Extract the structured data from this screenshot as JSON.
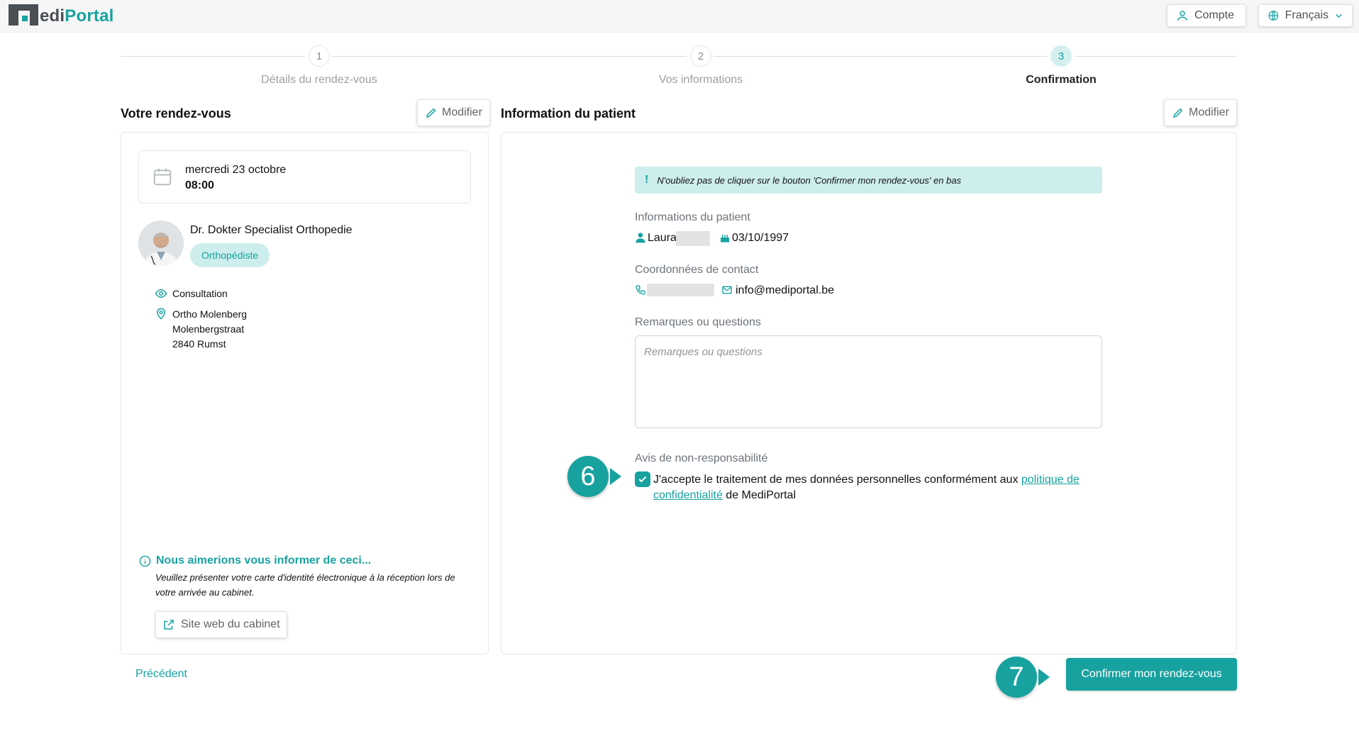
{
  "header": {
    "logo_prefix": "M",
    "logo_dark": "edi",
    "logo_teal": "Portal",
    "account_label": "Compte",
    "language_label": "Français"
  },
  "stepper": {
    "steps": [
      {
        "number": "1",
        "label": "Détails du rendez-vous"
      },
      {
        "number": "2",
        "label": "Vos informations"
      },
      {
        "number": "3",
        "label": "Confirmation"
      }
    ],
    "active_step": 3
  },
  "appointment": {
    "title": "Votre rendez-vous",
    "modify_label": "Modifier",
    "date": "mercredi 23 octobre",
    "time": "08:00",
    "doctor_name": "Dr. Dokter Specialist Orthopedie",
    "specialty": "Orthopédiste",
    "visit_type": "Consultation",
    "location_name": "Ortho Molenberg",
    "location_street": "Molenbergstraat",
    "location_city": "2840 Rumst",
    "notice_title": "Nous aimerions vous informer de ceci...",
    "notice_text": "Veuillez présenter votre carte d'identité électronique à la réception lors de votre arrivée au cabinet.",
    "website_label": "Site web du cabinet"
  },
  "patient": {
    "title": "Information du patient",
    "modify_label": "Modifier",
    "alert_text": "N'oubliez pas de cliquer sur le bouton 'Confirmer mon rendez-vous' en bas",
    "patient_info_label": "Informations du patient",
    "first_name": "Laura",
    "birth_date": "03/10/1997",
    "contact_label": "Coordonnées de contact",
    "email": "info@mediportal.be",
    "remarks_label": "Remarques ou questions",
    "remarks_placeholder": "Remarques ou questions",
    "disclaimer_label": "Avis de non-responsabilité",
    "consent_checked": true,
    "consent_text_before": "J'accepte le traitement de mes données personnelles conformément aux ",
    "consent_link": "politique de confidentialité",
    "consent_text_after": " de MediPortal"
  },
  "markers": {
    "consent_marker": "6",
    "confirm_marker": "7"
  },
  "footer": {
    "previous_label": "Précédent",
    "confirm_label": "Confirmer mon rendez-vous"
  },
  "colors": {
    "accent": "#17a2a0",
    "accent_light": "#cdeeed",
    "logo_dark": "#4a4f54"
  }
}
